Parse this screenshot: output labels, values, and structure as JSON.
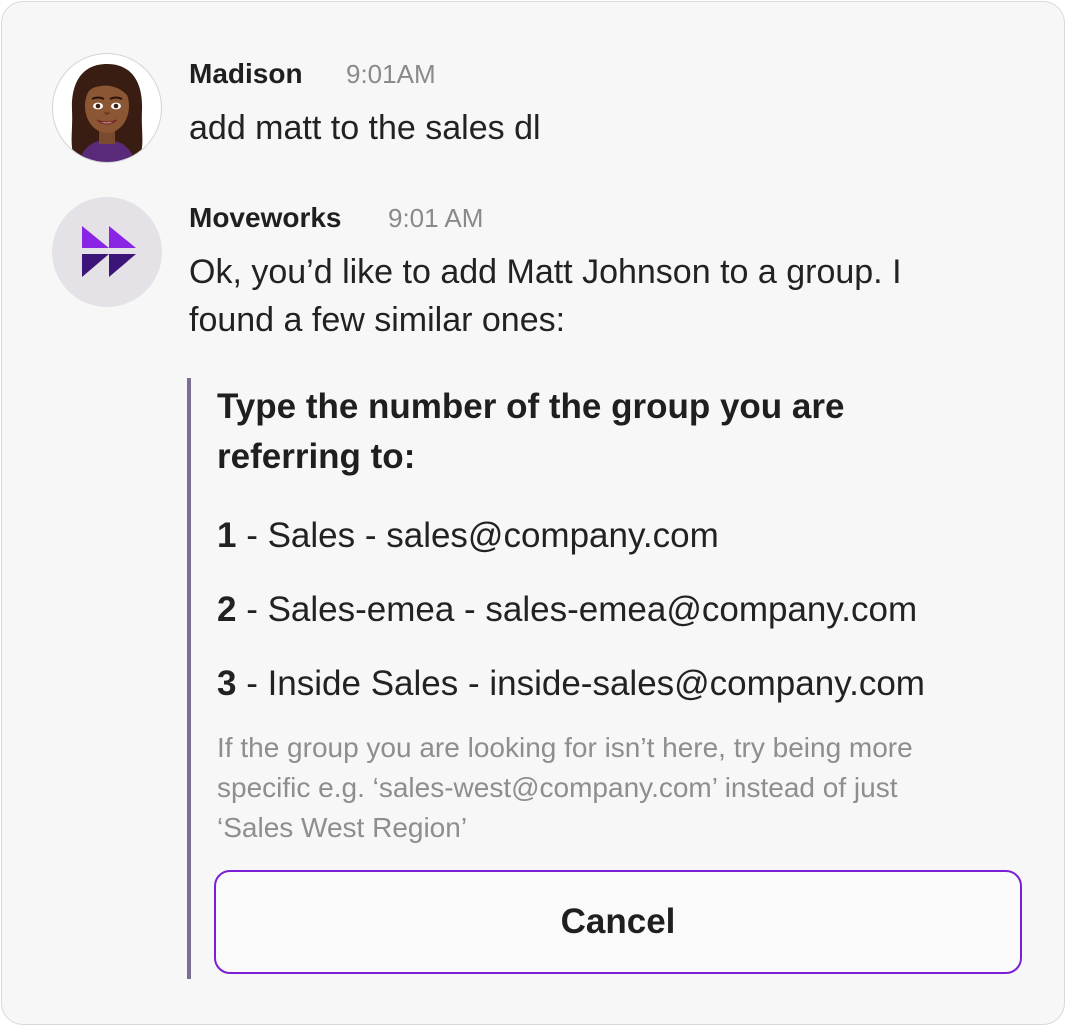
{
  "messages": [
    {
      "sender": "Madison",
      "time": "9:01AM",
      "text": "add matt to the sales dl",
      "avatar_icon": "bitmoji-avatar-icon"
    },
    {
      "sender": "Moveworks",
      "time": "9:01 AM",
      "text_line1": "Ok, you’d like to add Matt Johnson to a group. I",
      "text_line2": "found a few similar ones:",
      "avatar_icon": "moveworks-logo-icon"
    }
  ],
  "prompt": {
    "title_line1": "Type the number of the group you are",
    "title_line2": "referring to:",
    "options": [
      {
        "number": "1",
        "text": " - Sales - sales@company.com"
      },
      {
        "number": "2",
        "text": " - Sales-emea - sales-emea@company.com"
      },
      {
        "number": "3",
        "text": " - Inside Sales - inside-sales@company.com"
      }
    ],
    "hint_line1": "If the group you are looking for isn’t here, try being more",
    "hint_line2": "specific e.g. ‘sales-west@company.com’ instead of just",
    "hint_line3": "‘Sales West Region’",
    "cancel_label": "Cancel"
  },
  "colors": {
    "accent": "#7b1fd6",
    "quote_bar": "#7a6f90",
    "card_background": "#f7f7f7",
    "timestamp": "#8a8a8a",
    "hint_text": "#8e8e8e"
  }
}
